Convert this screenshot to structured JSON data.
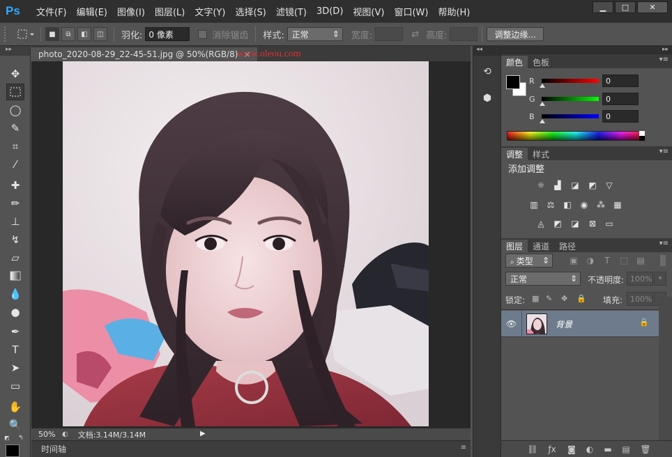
{
  "app": {
    "logo": "Ps",
    "menu": [
      "文件(F)",
      "编辑(E)",
      "图像(I)",
      "图层(L)",
      "文字(Y)",
      "选择(S)",
      "滤镜(T)",
      "3D(D)",
      "视图(V)",
      "窗口(W)",
      "帮助(H)"
    ],
    "window_controls": {
      "minimize": "▁",
      "maximize": "□",
      "close": "✕"
    }
  },
  "options_bar": {
    "feather_label": "羽化:",
    "feather_value": "0 像素",
    "antialias_label": "消除锯齿",
    "style_label": "样式:",
    "style_value": "正常",
    "width_label": "宽度:",
    "height_label": "高度:",
    "refine_edge": "调整边缘..."
  },
  "document": {
    "tab_title": "photo_2020-08-29_22-45-51.jpg @ 50%(RGB/8)",
    "watermark": "www.oleou.com",
    "zoom": "50%",
    "doc_info": "文档:3.14M/3.14M"
  },
  "timeline": {
    "label": "时间轴"
  },
  "color_panel": {
    "tabs": [
      "颜色",
      "色板"
    ],
    "active_tab": 0,
    "foreground": "#000000",
    "background": "#ffffff",
    "channels": [
      {
        "label": "R",
        "value": "0",
        "gradient": "linear-gradient(to right, #000000, #ff0000)"
      },
      {
        "label": "G",
        "value": "0",
        "gradient": "linear-gradient(to right, #000000, #00ff00)"
      },
      {
        "label": "B",
        "value": "0",
        "gradient": "linear-gradient(to right, #000000, #0000ff)"
      }
    ]
  },
  "adjustments_panel": {
    "tabs": [
      "调整",
      "样式"
    ],
    "active_tab": 0,
    "title": "添加调整"
  },
  "layers_panel": {
    "tabs": [
      "图层",
      "通道",
      "路径"
    ],
    "active_tab": 0,
    "filter_kind": "类型",
    "blend_mode": "正常",
    "opacity_label": "不透明度:",
    "opacity_value": "100%",
    "lock_label": "锁定:",
    "fill_label": "填充:",
    "fill_value": "100%",
    "layers": [
      {
        "name": "背景",
        "visible": true,
        "locked": true
      }
    ]
  }
}
